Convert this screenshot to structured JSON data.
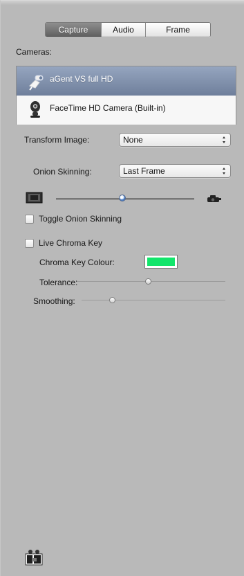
{
  "tabs": [
    {
      "label": "Capture",
      "selected": true
    },
    {
      "label": "Audio",
      "selected": false
    },
    {
      "label": "Frame",
      "selected": false
    }
  ],
  "cameras": {
    "label": "Cameras:",
    "items": [
      {
        "name": "aGent VS full HD",
        "selected": true,
        "icon": "webcam-icon"
      },
      {
        "name": "FaceTime HD Camera (Built-in)",
        "selected": false,
        "icon": "facetime-camera-icon"
      }
    ]
  },
  "transform_image": {
    "label": "Transform Image:",
    "value": "None"
  },
  "onion_skinning": {
    "label": "Onion Skinning:",
    "value": "Last Frame",
    "slider_value": 0.43
  },
  "toggle_onion_skinning": {
    "label": "Toggle Onion Skinning",
    "checked": false
  },
  "live_chroma_key": {
    "label": "Live Chroma Key",
    "checked": false,
    "colour_label": "Chroma Key Colour:",
    "colour": "#12e56b",
    "tolerance_label": "Tolerance:",
    "tolerance_value": 0.49,
    "smoothing_label": "Smoothing:",
    "smoothing_value": 0.19
  },
  "footer": {
    "icon": "camera-capture-icon"
  }
}
